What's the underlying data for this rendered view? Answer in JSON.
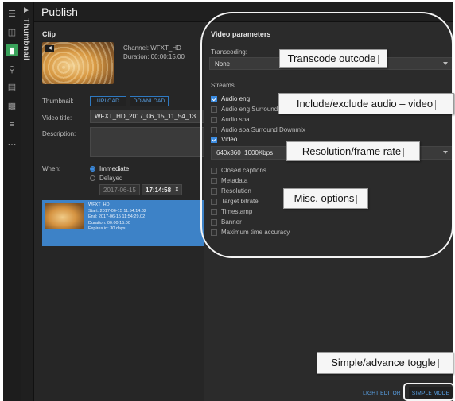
{
  "header": {
    "title": "Publish"
  },
  "rail": {
    "icons": [
      "menu-icon",
      "layout-icon",
      "bookmark-icon",
      "search-icon",
      "list-icon",
      "publish-icon",
      "queue-icon",
      "more-icon"
    ]
  },
  "strip": {
    "label": "Thumbnail"
  },
  "clip": {
    "section_label": "Clip",
    "channel_line": "Channel: WFXT_HD",
    "duration_line": "Duration: 00:00:15.00",
    "thumbnail_label": "Thumbnail:",
    "upload_label": "UPLOAD",
    "download_label": "DOWNLOAD",
    "video_title_label": "Video title:",
    "video_title_value": "WFXT_HD_2017_06_15_11_54_13",
    "description_label": "Description:",
    "description_value": "",
    "when_label": "When:",
    "immediate_label": "Immediate",
    "delayed_label": "Delayed",
    "date_value": "2017-06-15",
    "time_value": "17:14:58",
    "card": {
      "name": "WFXT_HD",
      "start": "Start: 2017-06-15 11:54:14.02",
      "end": "End: 2017-06-15 11:54:29.02",
      "duration": "Duration: 00:00:15.00",
      "expires": "Expires in: 30 days"
    }
  },
  "video_params": {
    "section_label": "Video parameters",
    "transcoding_label": "Transcoding:",
    "transcoding_value": "None",
    "streams_label": "Streams",
    "streams": [
      {
        "label": "Audio eng",
        "checked": true
      },
      {
        "label": "Audio eng Surround D",
        "checked": false
      },
      {
        "label": "Audio spa",
        "checked": false
      },
      {
        "label": "Audio spa Surround Downmix",
        "checked": false
      },
      {
        "label": "Video",
        "checked": true
      }
    ],
    "resolution_value": "640x360_1000Kbps",
    "options": [
      {
        "label": "Closed captions",
        "checked": false
      },
      {
        "label": "Metadata",
        "checked": false
      },
      {
        "label": "Resolution",
        "checked": false
      },
      {
        "label": "Target bitrate",
        "checked": false
      },
      {
        "label": "Timestamp",
        "checked": false
      },
      {
        "label": "Banner",
        "checked": false
      },
      {
        "label": "Maximum time accuracy",
        "checked": false
      }
    ]
  },
  "bottom": {
    "light_editor_label": "LIGHT EDITOR",
    "simple_mode_label": "SIMPLE MODE"
  },
  "annotations": {
    "transcode": "Transcode outcode",
    "audio_video": "Include/exclude audio – video",
    "resolution": "Resolution/frame rate",
    "misc": "Misc. options",
    "toggle": "Simple/advance toggle"
  }
}
